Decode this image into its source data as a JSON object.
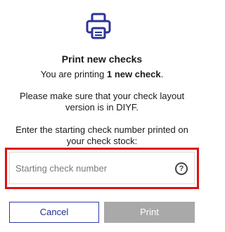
{
  "dialog": {
    "icon": "printer-icon",
    "title": "Print new checks",
    "intro_prefix": "You are printing ",
    "intro_bold": "1 new check",
    "intro_suffix": ".",
    "layout_note_line1": "Please make sure that your check layout",
    "layout_note_line2": "version is in DIYF.",
    "instruction_line1": "Enter the starting check number printed on",
    "instruction_line2": "your check stock:",
    "input": {
      "value": "",
      "placeholder": "Starting check number",
      "help_icon": "question-circle-icon",
      "help_glyph": "?"
    },
    "buttons": {
      "cancel_label": "Cancel",
      "print_label": "Print"
    }
  },
  "colors": {
    "accent": "#2b3494",
    "highlight": "#e01010",
    "disabled_button": "#a9a9a9"
  }
}
